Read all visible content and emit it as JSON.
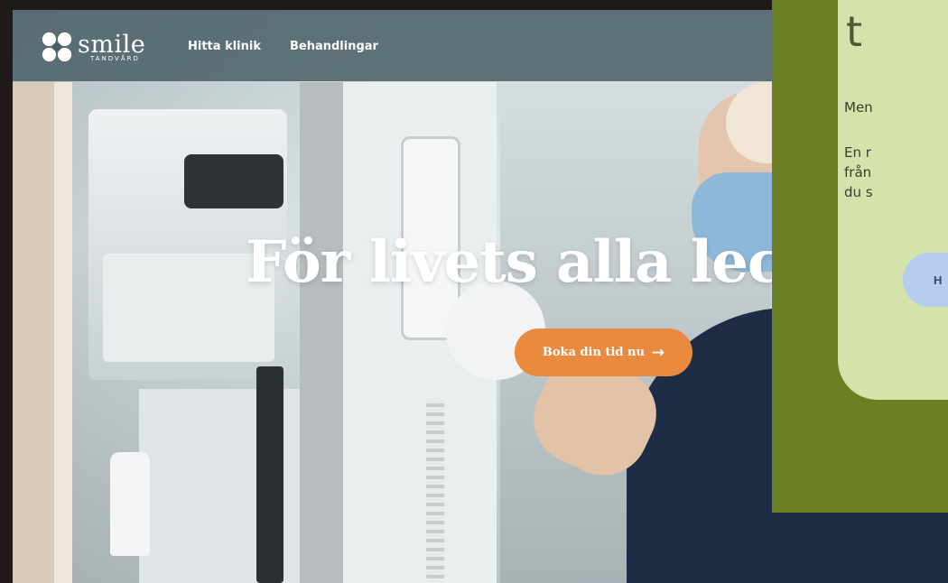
{
  "header": {
    "logo": {
      "word": "smile",
      "sub": "TANDVÅRD"
    },
    "nav": [
      {
        "label": "Hitta klinik"
      },
      {
        "label": "Behandlingar"
      }
    ]
  },
  "hero": {
    "title": "För livets alla lec",
    "cta_label": "Boka din tid nu",
    "cta_arrow": "→"
  },
  "overlay": {
    "heading": "t",
    "line1": "Men",
    "line2": "En r",
    "line3": "från",
    "line4": "du s",
    "button_label": "H"
  },
  "colors": {
    "header_bg": "#4a6068",
    "cta": "#ea8a3e",
    "panel_bg": "#6b7f24",
    "card_bg": "#d3e3ab",
    "card_button": "#b6cdef"
  }
}
